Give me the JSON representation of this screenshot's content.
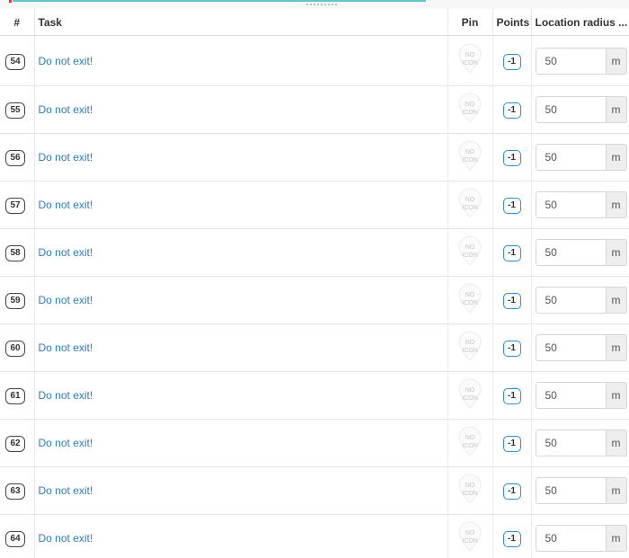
{
  "table": {
    "headers": {
      "num": "#",
      "task": "Task",
      "pin": "Pin",
      "points": "Points",
      "radius": "Location radius ..."
    },
    "pin_placeholder": "NO\nICON",
    "rows": [
      {
        "num": "54",
        "task": "Do not exit!",
        "pin_line1": "NO",
        "pin_line2": "ICON",
        "points": "-1",
        "radius": "50",
        "unit": "m"
      },
      {
        "num": "55",
        "task": "Do not exit!",
        "pin_line1": "NO",
        "pin_line2": "ICON",
        "points": "-1",
        "radius": "50",
        "unit": "m"
      },
      {
        "num": "56",
        "task": "Do not exit!",
        "pin_line1": "NO",
        "pin_line2": "ICON",
        "points": "-1",
        "radius": "50",
        "unit": "m"
      },
      {
        "num": "57",
        "task": "Do not exit!",
        "pin_line1": "NO",
        "pin_line2": "ICON",
        "points": "-1",
        "radius": "50",
        "unit": "m"
      },
      {
        "num": "58",
        "task": "Do not exit!",
        "pin_line1": "NO",
        "pin_line2": "ICON",
        "points": "-1",
        "radius": "50",
        "unit": "m"
      },
      {
        "num": "59",
        "task": "Do not exit!",
        "pin_line1": "NO",
        "pin_line2": "ICON",
        "points": "-1",
        "radius": "50",
        "unit": "m"
      },
      {
        "num": "60",
        "task": "Do not exit!",
        "pin_line1": "NO",
        "pin_line2": "ICON",
        "points": "-1",
        "radius": "50",
        "unit": "m"
      },
      {
        "num": "61",
        "task": "Do not exit!",
        "pin_line1": "NO",
        "pin_line2": "ICON",
        "points": "-1",
        "radius": "50",
        "unit": "m"
      },
      {
        "num": "62",
        "task": "Do not exit!",
        "pin_line1": "NO",
        "pin_line2": "ICON",
        "points": "-1",
        "radius": "50",
        "unit": "m"
      },
      {
        "num": "63",
        "task": "Do not exit!",
        "pin_line1": "NO",
        "pin_line2": "ICON",
        "points": "-1",
        "radius": "50",
        "unit": "m"
      },
      {
        "num": "64",
        "task": "Do not exit!",
        "pin_line1": "NO",
        "pin_line2": "ICON",
        "points": "-1",
        "radius": "50",
        "unit": "m"
      }
    ]
  },
  "colors": {
    "link": "#2e7bbf",
    "points_border": "#2b8fd3",
    "accent_bar": "#5fc9c9"
  }
}
